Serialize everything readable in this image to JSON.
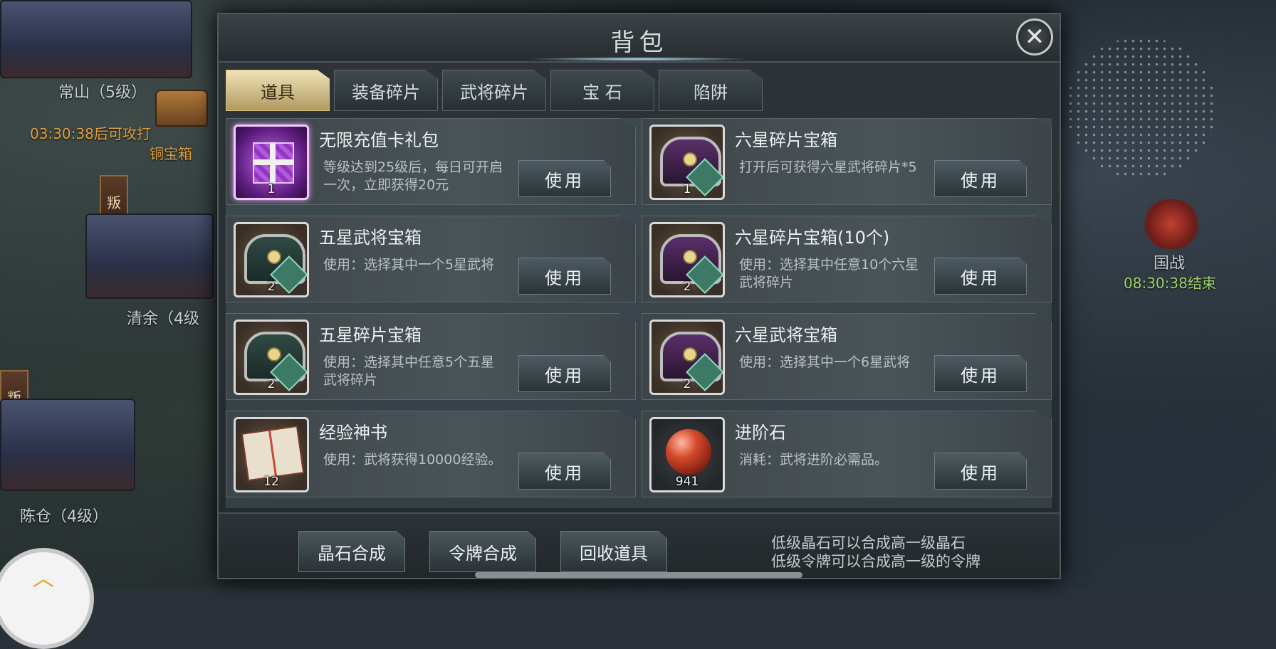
{
  "window": {
    "title": "背包",
    "close_icon": "close-icon"
  },
  "tabs": [
    {
      "label": "道具",
      "active": true
    },
    {
      "label": "装备碎片",
      "active": false
    },
    {
      "label": "武将碎片",
      "active": false
    },
    {
      "label": "宝 石",
      "active": false
    },
    {
      "label": "陷阱",
      "active": false
    }
  ],
  "items": [
    {
      "name": "无限充值卡礼包",
      "desc": "等级达到25级后，每日可开启一次，立即获得20元",
      "count": "1",
      "icon": "gift-box-icon",
      "button": "使用"
    },
    {
      "name": "六星碎片宝箱",
      "desc": "打开后可获得六星武将碎片*5",
      "count": "1",
      "icon": "six-star-chest-icon",
      "star_glyph": "六",
      "button": "使用"
    },
    {
      "name": "五星武将宝箱",
      "desc": "使用：选择其中一个5星武将",
      "count": "2",
      "icon": "five-star-chest-icon",
      "star_glyph": "五",
      "button": "使用"
    },
    {
      "name": "六星碎片宝箱(10个)",
      "desc": "使用：选择其中任意10个六星武将碎片",
      "count": "2",
      "icon": "six-star-chest-icon",
      "star_glyph": "六",
      "button": "使用"
    },
    {
      "name": "五星碎片宝箱",
      "desc": "使用：选择其中任意5个五星武将碎片",
      "count": "2",
      "icon": "five-star-chest-icon",
      "star_glyph": "五",
      "button": "使用"
    },
    {
      "name": "六星武将宝箱",
      "desc": "使用：选择其中一个6星武将",
      "count": "2",
      "icon": "six-star-chest-icon",
      "star_glyph": "六",
      "button": "使用"
    },
    {
      "name": "经验神书",
      "desc": "使用：武将获得10000经验。",
      "count": "12",
      "icon": "exp-book-icon",
      "button": "使用"
    },
    {
      "name": "进阶石",
      "desc": "消耗：武将进阶必需品。",
      "count": "941",
      "icon": "advance-stone-icon",
      "button": "使用"
    }
  ],
  "footer": {
    "buttons": [
      "晶石合成",
      "令牌合成",
      "回收道具"
    ],
    "hint_line1": "低级晶石可以合成高一级晶石",
    "hint_line2": "低级令牌可以合成高一级的令牌"
  },
  "map": {
    "labels": {
      "changshan": "常山（5级）",
      "attack_timer": "03:30:38后可攻打",
      "bronze_chest": "铜宝箱",
      "qingyu": "清余（4级",
      "chencang": "陈仓（4级）",
      "guozhan": "国战",
      "guozhan_timer": "08:30:38结束",
      "rebel": "叛"
    }
  },
  "colors": {
    "active_tab": "#d8c07e",
    "panel": "#2e3438",
    "timer_orange": "#e0a140",
    "timer_green": "#9ed36a"
  }
}
